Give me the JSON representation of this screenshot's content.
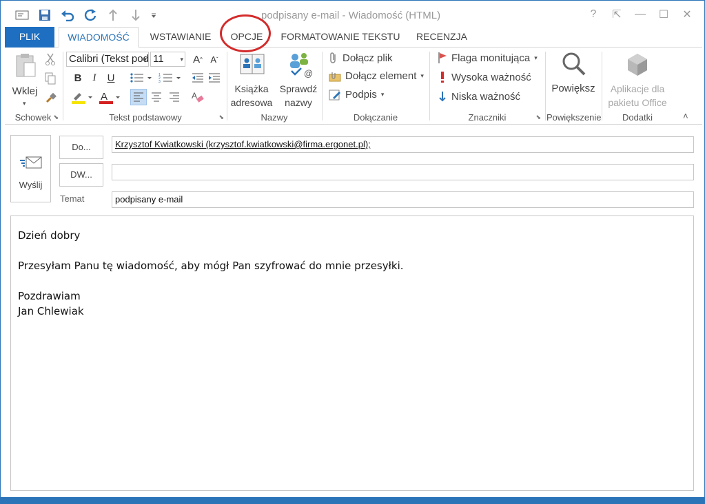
{
  "window": {
    "title": "podpisany e-mail - Wiadomość (HTML)",
    "controls": [
      "?",
      "⇱",
      "—",
      "☐",
      "✕"
    ]
  },
  "tabs": [
    {
      "label": "PLIK"
    },
    {
      "label": "WIADOMOŚĆ"
    },
    {
      "label": "WSTAWIANIE"
    },
    {
      "label": "OPCJE"
    },
    {
      "label": "FORMATOWANIE TEKSTU"
    },
    {
      "label": "RECENZJA"
    }
  ],
  "ribbon": {
    "clipboard": {
      "paste_label": "Wklej",
      "group_label": "Schowek"
    },
    "basic_text": {
      "font_name": "Calibri (Tekst pods",
      "font_size": "11",
      "group_label": "Tekst podstawowy",
      "bold": "B",
      "italic": "I",
      "underline": "U"
    },
    "names": {
      "address_book": "Książka adresowa",
      "check_names": "Sprawdź nazwy",
      "group_label": "Nazwy"
    },
    "include": {
      "attach_file": "Dołącz plik",
      "attach_item": "Dołącz element",
      "signature": "Podpis",
      "group_label": "Dołączanie"
    },
    "tags": {
      "follow_up": "Flaga monitująca",
      "high_importance": "Wysoka ważność",
      "low_importance": "Niska ważność",
      "group_label": "Znaczniki"
    },
    "zoom": {
      "zoom_label": "Powiększ",
      "group_label": "Powiększenie"
    },
    "addins": {
      "office_apps": "Aplikacje dla pakietu Office",
      "group_label": "Dodatki"
    }
  },
  "compose": {
    "send_label": "Wyślij",
    "to_button": "Do...",
    "cc_button": "DW...",
    "subject_label": "Temat",
    "to_value": "Krzysztof Kwiatkowski (krzysztof.kwiatkowski@firma.ergonet.pl);",
    "cc_value": "",
    "subject_value": "podpisany e-mail"
  },
  "body": {
    "lines": [
      "Dzień dobry",
      "",
      "Przesyłam Panu tę wiadomość, aby mógł Pan szyfrować do mnie przesyłki.",
      "",
      "Pozdrawiam",
      "Jan Chlewiak"
    ]
  },
  "colors": {
    "accent": "#2b74b8",
    "file_tab": "#1e6fc1",
    "annotation": "#d42b2b"
  }
}
